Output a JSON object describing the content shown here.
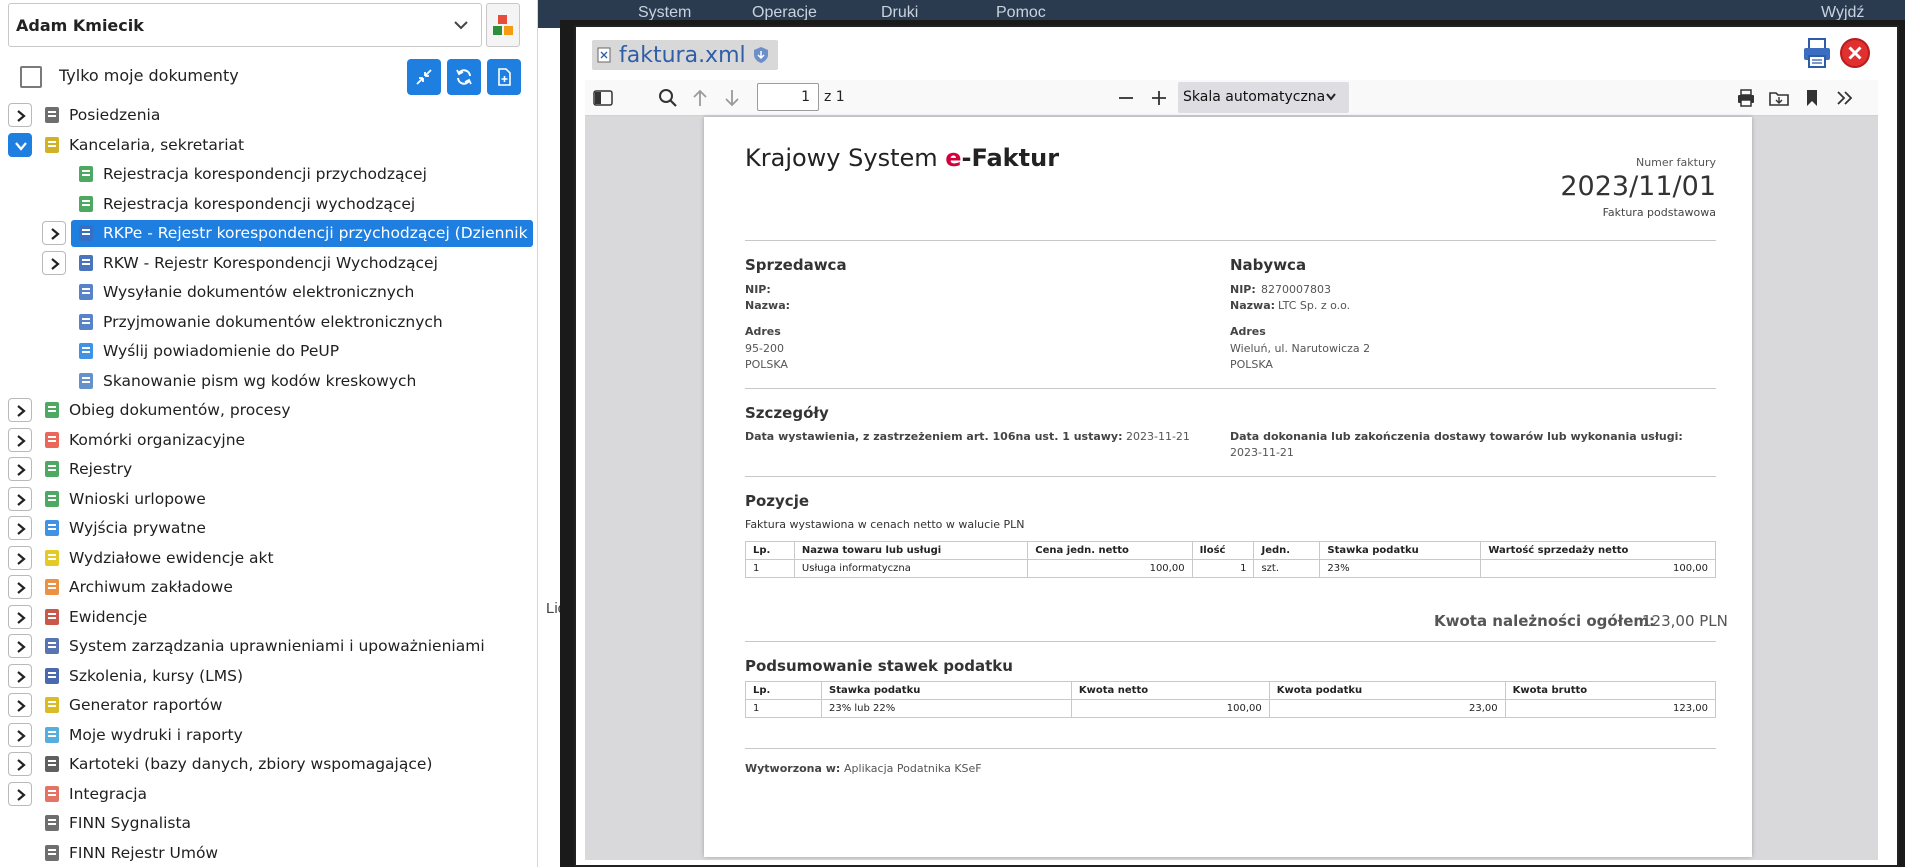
{
  "user": {
    "name": "Adam Kmiecik"
  },
  "filters": {
    "only_mine_label": "Tylko moje dokumenty"
  },
  "tree": [
    {
      "label": "Posiedzenia",
      "icon": "meeting-people-icon",
      "level": 0,
      "expander": "closed"
    },
    {
      "label": "Kancelaria, sekretariat",
      "icon": "office-folder-icon",
      "level": 0,
      "expander": "open"
    },
    {
      "label": "Rejestracja korespondencji przychodzącej",
      "icon": "incoming-register-icon",
      "level": 1,
      "expander": "none"
    },
    {
      "label": "Rejestracja korespondencji wychodzącej",
      "icon": "outgoing-register-icon",
      "level": 1,
      "expander": "none"
    },
    {
      "label": "RKPe - Rejestr korespondencji przychodzącej (Dziennik wr",
      "icon": "register-book-icon",
      "level": 1,
      "expander": "closed",
      "selected": true
    },
    {
      "label": "RKW - Rejestr Korespondencji Wychodzącej",
      "icon": "register-book-blue-icon",
      "level": 1,
      "expander": "closed"
    },
    {
      "label": "Wysyłanie dokumentów elektronicznych",
      "icon": "send-envelope-icon",
      "level": 1,
      "expander": "none"
    },
    {
      "label": "Przyjmowanie dokumentów elektronicznych",
      "icon": "receive-envelope-icon",
      "level": 1,
      "expander": "none"
    },
    {
      "label": "Wyślij powiadomienie do PeUP",
      "icon": "internet-explorer-icon",
      "level": 1,
      "expander": "none"
    },
    {
      "label": "Skanowanie pism wg kodów kreskowych",
      "icon": "scanner-icon",
      "level": 1,
      "expander": "none"
    },
    {
      "label": "Obieg dokumentów, procesy",
      "icon": "workflow-cycle-icon",
      "level": 0,
      "expander": "closed"
    },
    {
      "label": "Komórki organizacyjne",
      "icon": "org-units-icon",
      "level": 0,
      "expander": "closed"
    },
    {
      "label": "Rejestry",
      "icon": "registers-icon",
      "level": 0,
      "expander": "closed"
    },
    {
      "label": "Wnioski urlopowe",
      "icon": "palm-tree-icon",
      "level": 0,
      "expander": "closed"
    },
    {
      "label": "Wyjścia prywatne",
      "icon": "walking-person-icon",
      "level": 0,
      "expander": "closed"
    },
    {
      "label": "Wydziałowe ewidencje akt",
      "icon": "binders-icon",
      "level": 0,
      "expander": "closed"
    },
    {
      "label": "Archiwum zakładowe",
      "icon": "archive-drawers-icon",
      "level": 0,
      "expander": "closed"
    },
    {
      "label": "Ewidencje",
      "icon": "records-book-icon",
      "level": 0,
      "expander": "closed"
    },
    {
      "label": "System zarządzania uprawnieniami i upoważnieniami",
      "icon": "permissions-shield-icon",
      "level": 0,
      "expander": "closed"
    },
    {
      "label": "Szkolenia, kursy (LMS)",
      "icon": "graduation-cap-icon",
      "level": 0,
      "expander": "closed"
    },
    {
      "label": "Generator raportów",
      "icon": "ruler-report-icon",
      "level": 0,
      "expander": "closed"
    },
    {
      "label": "Moje wydruki i raporty",
      "icon": "my-reports-icon",
      "level": 0,
      "expander": "closed"
    },
    {
      "label": "Kartoteki (bazy danych, zbiory wspomagające)",
      "icon": "card-index-icon",
      "level": 0,
      "expander": "closed"
    },
    {
      "label": "Integracja",
      "icon": "integration-icon",
      "level": 0,
      "expander": "closed"
    },
    {
      "label": "FINN Sygnalista",
      "icon": "megaphone-icon",
      "level": 0,
      "expander": "none"
    },
    {
      "label": "FINN Rejestr Umów",
      "icon": "handshake-icon",
      "level": 0,
      "expander": "none"
    }
  ],
  "bg_menu": [
    "System",
    "Operacje",
    "Druki",
    "Pomoc",
    "Wyjdź"
  ],
  "bg_left_text": "Lic",
  "modal": {
    "file_name": "faktura.xml"
  },
  "pdf": {
    "page_current": "1",
    "page_of": "z 1",
    "zoom": "Skala automatyczna"
  },
  "invoice": {
    "brand_prefix": "Krajowy System ",
    "brand_e": "e",
    "brand_suffix": "-Faktur",
    "number_label": "Numer faktury",
    "number": "2023/11/01",
    "type": "Faktura podstawowa",
    "seller_title": "Sprzedawca",
    "buyer_title": "Nabywca",
    "nip_label": "NIP:",
    "name_label": "Nazwa:",
    "address_label": "Adres",
    "seller": {
      "nip": "",
      "name": "",
      "addr1": "95-200",
      "country": "POLSKA"
    },
    "buyer": {
      "nip": "8270007803",
      "name": "LTC Sp. z o.o.",
      "addr1": "Wieluń, ul. Narutowicza 2",
      "country": "POLSKA"
    },
    "details_title": "Szczegóły",
    "issue_label": "Data wystawienia, z zastrzeżeniem art. 106na ust. 1 ustawy:",
    "issue_date": "2023-11-21",
    "delivery_label": "Data dokonania lub zakończenia dostawy towarów lub wykonania usługi:",
    "delivery_date": "2023-11-21",
    "positions_title": "Pozycje",
    "positions_note": "Faktura wystawiona w cenach netto w walucie PLN",
    "positions_headers": [
      "Lp.",
      "Nazwa towaru lub usługi",
      "Cena jedn. netto",
      "Ilość",
      "Jedn.",
      "Stawka podatku",
      "Wartość sprzedaży netto"
    ],
    "positions_rows": [
      [
        "1",
        "Usługa informatyczna",
        "100,00",
        "1",
        "szt.",
        "23%",
        "100,00"
      ]
    ],
    "total_label": "Kwota należności ogółem:",
    "total_value": "123,00 PLN",
    "summary_title": "Podsumowanie stawek podatku",
    "summary_headers": [
      "Lp.",
      "Stawka podatku",
      "Kwota netto",
      "Kwota podatku",
      "Kwota brutto"
    ],
    "summary_rows": [
      [
        "1",
        "23% lub 22%",
        "100,00",
        "23,00",
        "123,00"
      ]
    ],
    "generated_label": "Wytworzona w:",
    "generated_value": "Aplikacja Podatnika KSeF"
  }
}
